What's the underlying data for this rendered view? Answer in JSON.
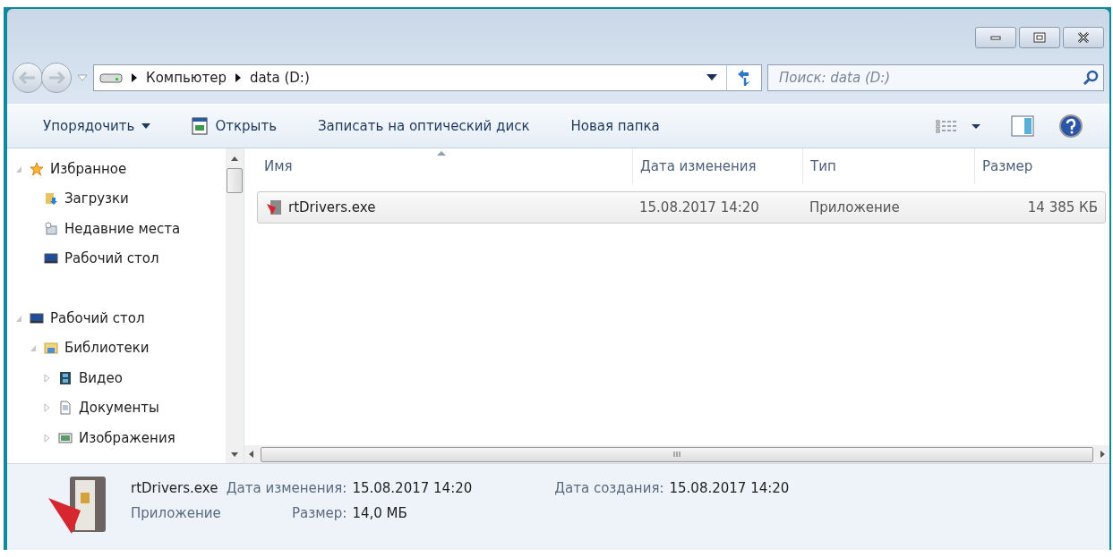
{
  "address": {
    "crumbs": [
      "Компьютер",
      "data (D:)"
    ]
  },
  "search": {
    "placeholder": "Поиск: data (D:)"
  },
  "toolbar": {
    "items": [
      {
        "label": "Упорядочить",
        "kind": "menu"
      },
      {
        "label": "Открыть",
        "kind": "icon"
      },
      {
        "label": "Записать на оптический диск",
        "kind": "plain"
      },
      {
        "label": "Новая папка",
        "kind": "plain"
      }
    ]
  },
  "sidebar": {
    "items": [
      {
        "label": "Избранное",
        "expanded": true,
        "children": [
          {
            "label": "Загрузки"
          },
          {
            "label": "Недавние места"
          },
          {
            "label": "Рабочий стол"
          }
        ]
      },
      {
        "label": "Рабочий стол",
        "expanded": true,
        "children": [
          {
            "label": "Библиотеки",
            "expanded": true,
            "children": [
              {
                "label": "Видео",
                "expanded": false
              },
              {
                "label": "Документы",
                "expanded": false
              },
              {
                "label": "Изображения",
                "expanded": false
              }
            ]
          }
        ]
      }
    ]
  },
  "table": {
    "columns": [
      "Имя",
      "Дата изменения",
      "Тип",
      "Размер"
    ],
    "rows": [
      {
        "cells": [
          "rtDrivers.exe",
          "15.08.2017 14:20",
          "Приложение",
          "14 385 КБ"
        ],
        "selected": true
      }
    ]
  },
  "details": {
    "name": "rtDrivers.exe",
    "type": "Приложение",
    "fields": [
      {
        "label": "Дата изменения:",
        "value": "15.08.2017 14:20"
      },
      {
        "label": "Размер:",
        "value": "14,0 МБ"
      },
      {
        "label": "Дата создания:",
        "value": "15.08.2017 14:20"
      }
    ]
  }
}
